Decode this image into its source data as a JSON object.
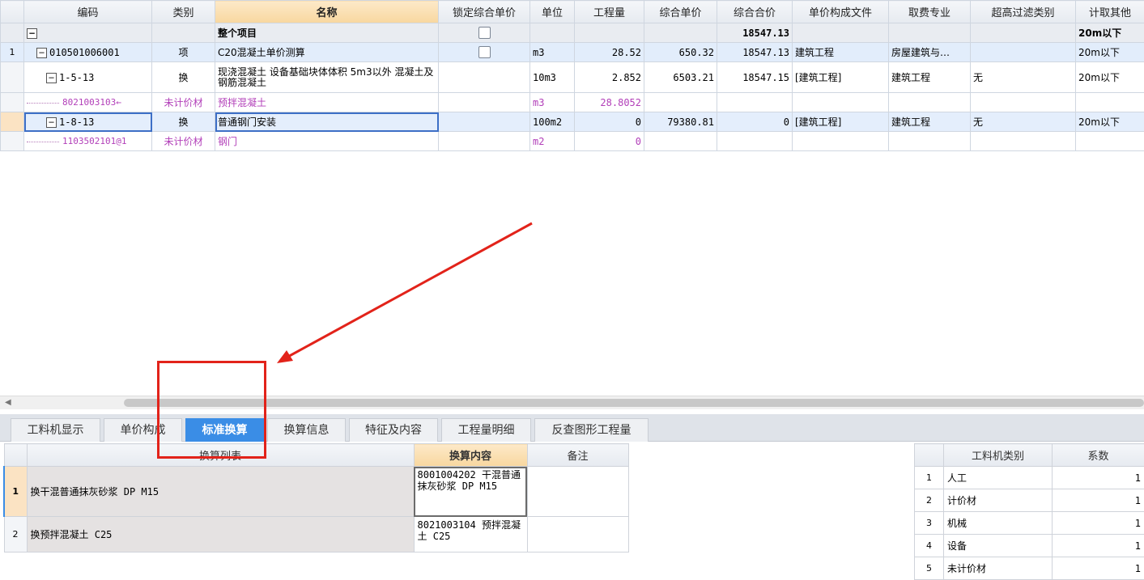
{
  "top_grid": {
    "headers": [
      "",
      "编码",
      "类别",
      "名称",
      "锁定综合单价",
      "单位",
      "工程量",
      "综合单价",
      "综合合价",
      "单价构成文件",
      "取费专业",
      "超高过滤类别",
      "计取其他"
    ],
    "rows": [
      {
        "no": "",
        "code": "",
        "type": "",
        "name": "整个项目",
        "unit": "",
        "qty": "",
        "price": "",
        "total": "18547.13",
        "file": "",
        "major": "",
        "filter": "",
        "extra": "20m以下"
      },
      {
        "no": "1",
        "code": "010501006001",
        "type": "项",
        "name": "C20混凝土单价测算",
        "unit": "m3",
        "qty": "28.52",
        "price": "650.32",
        "total": "18547.13",
        "file": "建筑工程",
        "major": "房屋建筑与…",
        "filter": "",
        "extra": "20m以下"
      },
      {
        "no": "",
        "code": "1-5-13",
        "type": "换",
        "name": "现浇混凝土 设备基础块体体积 5m3以外 混凝土及钢筋混凝土",
        "unit": "10m3",
        "qty": "2.852",
        "price": "6503.21",
        "total": "18547.15",
        "file": "[建筑工程]",
        "major": "建筑工程",
        "filter": "无",
        "extra": "20m以下"
      },
      {
        "no": "",
        "code": "8021003103←",
        "type": "未计价材",
        "name": "预拌混凝土",
        "unit": "m3",
        "qty": "28.8052",
        "price": "",
        "total": "",
        "file": "",
        "major": "",
        "filter": "",
        "extra": ""
      },
      {
        "no": "",
        "code": "1-8-13",
        "type": "换",
        "name": "普通钢门安装",
        "unit": "100m2",
        "qty": "0",
        "price": "79380.81",
        "total": "0",
        "file": "[建筑工程]",
        "major": "建筑工程",
        "filter": "无",
        "extra": "20m以下"
      },
      {
        "no": "",
        "code": "1103502101@1",
        "type": "未计价材",
        "name": "钢门",
        "unit": "m2",
        "qty": "0",
        "price": "",
        "total": "",
        "file": "",
        "major": "",
        "filter": "",
        "extra": ""
      }
    ]
  },
  "scrollbar": {
    "left_arrow": "◀"
  },
  "tabs": [
    "工料机显示",
    "单价构成",
    "标准换算",
    "换算信息",
    "特征及内容",
    "工程量明细",
    "反查图形工程量"
  ],
  "active_tab": "标准换算",
  "conversion": {
    "headers": [
      "",
      "换算列表",
      "换算内容",
      "备注"
    ],
    "rows": [
      {
        "no": "1",
        "name": "换干混普通抹灰砂浆 DP M15",
        "content": "8001004202 干混普通抹灰砂浆 DP M15",
        "note": ""
      },
      {
        "no": "2",
        "name": "换预拌混凝土 C25",
        "content": "8021003104 预拌混凝土 C25",
        "note": ""
      }
    ]
  },
  "coefficients": {
    "headers": [
      "",
      "工料机类别",
      "系数"
    ],
    "rows": [
      {
        "no": "1",
        "category": "人工",
        "value": "1"
      },
      {
        "no": "2",
        "category": "计价材",
        "value": "1"
      },
      {
        "no": "3",
        "category": "机械",
        "value": "1"
      },
      {
        "no": "4",
        "category": "设备",
        "value": "1"
      },
      {
        "no": "5",
        "category": "未计价材",
        "value": "1"
      }
    ]
  },
  "colors": {
    "accent": "#3a8de6",
    "annotation": "#e2231a",
    "material_text": "#b23fb9"
  }
}
